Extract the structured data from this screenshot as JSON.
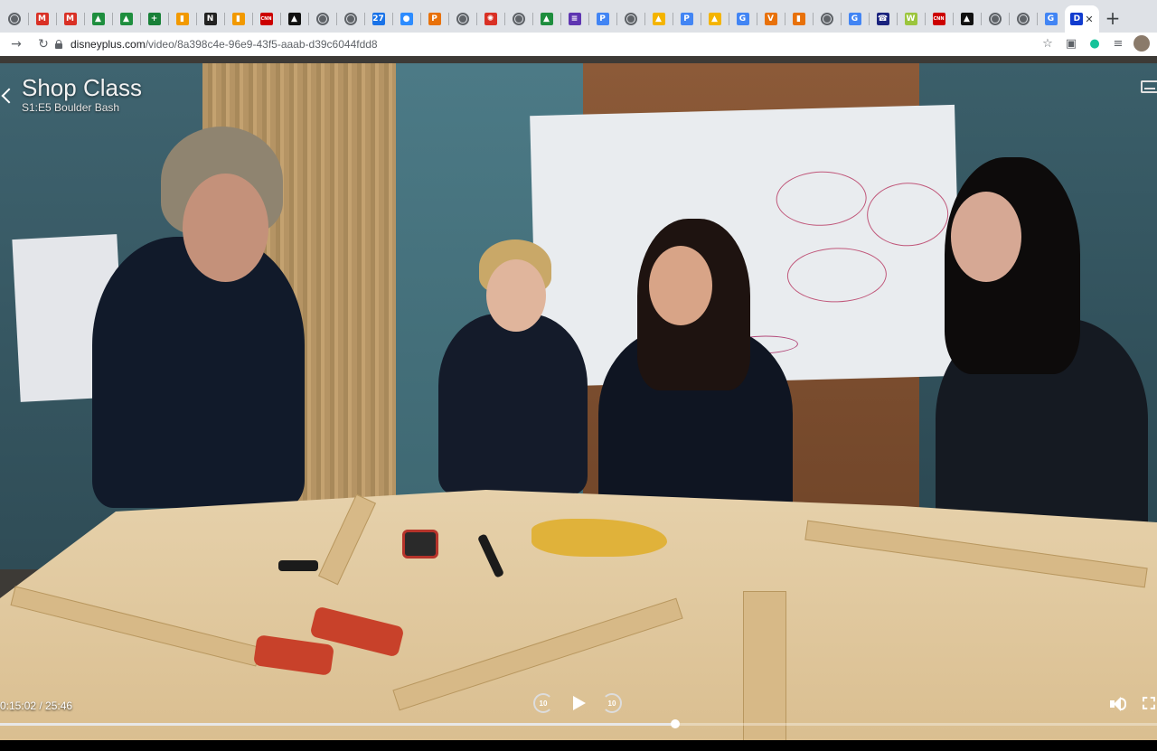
{
  "browser": {
    "tabs": [
      {
        "icon": "globe-icon",
        "glyph": "",
        "color": "#5f6368"
      },
      {
        "icon": "gmail-icon",
        "glyph": "M",
        "color": "#d93025"
      },
      {
        "icon": "gmail-icon",
        "glyph": "M",
        "color": "#d93025"
      },
      {
        "icon": "google-drive-icon",
        "glyph": "▲",
        "color": "#1e8e3e"
      },
      {
        "icon": "google-drive-icon",
        "glyph": "▲",
        "color": "#1e8e3e"
      },
      {
        "icon": "google-sheets-icon",
        "glyph": "+",
        "color": "#188038"
      },
      {
        "icon": "analytics-icon",
        "glyph": "▮",
        "color": "#f29900"
      },
      {
        "icon": "news-icon",
        "glyph": "N",
        "color": "#222"
      },
      {
        "icon": "analytics-icon",
        "glyph": "▮",
        "color": "#f29900"
      },
      {
        "icon": "cnn-icon",
        "glyph": "CNN",
        "color": "#cc0000"
      },
      {
        "icon": "app-icon",
        "glyph": "▲",
        "color": "#111"
      },
      {
        "icon": "globe-icon",
        "glyph": "",
        "color": "#5f6368"
      },
      {
        "icon": "globe-icon",
        "glyph": "",
        "color": "#5f6368"
      },
      {
        "icon": "calendar-icon",
        "glyph": "27",
        "color": "#1a73e8"
      },
      {
        "icon": "zoom-icon",
        "glyph": "●",
        "color": "#2d8cff"
      },
      {
        "icon": "app-icon",
        "glyph": "P",
        "color": "#e8710a"
      },
      {
        "icon": "globe-icon",
        "glyph": "",
        "color": "#5f6368"
      },
      {
        "icon": "app-icon",
        "glyph": "✺",
        "color": "#d93025"
      },
      {
        "icon": "globe-icon",
        "glyph": "",
        "color": "#5f6368"
      },
      {
        "icon": "google-drive-icon",
        "glyph": "▲",
        "color": "#1e8e3e"
      },
      {
        "icon": "app-icon",
        "glyph": "≡",
        "color": "#5e35b1"
      },
      {
        "icon": "app-icon",
        "glyph": "P",
        "color": "#4285f4"
      },
      {
        "icon": "globe-icon",
        "glyph": "",
        "color": "#5f6368"
      },
      {
        "icon": "app-icon",
        "glyph": "▲",
        "color": "#f4b400"
      },
      {
        "icon": "app-icon",
        "glyph": "P",
        "color": "#4285f4"
      },
      {
        "icon": "app-icon",
        "glyph": "▲",
        "color": "#f4b400"
      },
      {
        "icon": "google-icon",
        "glyph": "G",
        "color": "#4285f4"
      },
      {
        "icon": "app-icon",
        "glyph": "V",
        "color": "#e8710a"
      },
      {
        "icon": "app-icon",
        "glyph": "▮",
        "color": "#e8710a"
      },
      {
        "icon": "globe-icon",
        "glyph": "",
        "color": "#5f6368"
      },
      {
        "icon": "google-icon",
        "glyph": "G",
        "color": "#4285f4"
      },
      {
        "icon": "app-icon",
        "glyph": "☎",
        "color": "#1a237e"
      },
      {
        "icon": "app-icon",
        "glyph": "W",
        "color": "#9bc53d"
      },
      {
        "icon": "cnn-icon",
        "glyph": "CNN",
        "color": "#cc0000"
      },
      {
        "icon": "app-icon",
        "glyph": "▲",
        "color": "#111"
      },
      {
        "icon": "globe-icon",
        "glyph": "",
        "color": "#5f6368"
      },
      {
        "icon": "globe-icon",
        "glyph": "",
        "color": "#5f6368"
      },
      {
        "icon": "google-icon",
        "glyph": "G",
        "color": "#4285f4"
      }
    ],
    "active_tab": {
      "icon": "disney-plus-icon",
      "glyph": "D"
    },
    "url_host": "disneyplus.com",
    "url_path": "/video/8a398c4e-96e9-43f5-aaab-d39c6044fdd8"
  },
  "player": {
    "title": "Shop Class",
    "subtitle": "S1:E5 Boulder Bash",
    "elapsed": "0:15:02",
    "duration": "25:46",
    "time_display": "0:15:02 / 25:46",
    "skip_back_seconds": "10",
    "skip_forward_seconds": "10",
    "progress_fraction": 0.5835
  }
}
